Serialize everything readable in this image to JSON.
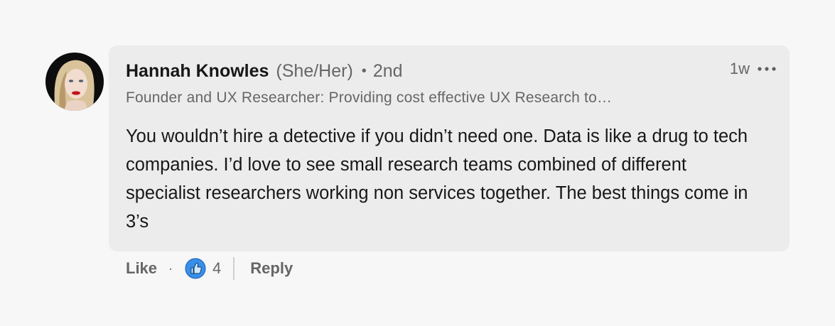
{
  "comment": {
    "author": {
      "name": "Hannah Knowles",
      "pronouns": "(She/Her)",
      "separator": "•",
      "connection_degree": "2nd",
      "headline": "Founder and UX Researcher: Providing cost effective UX Research to…",
      "avatar_icon": "profile-photo"
    },
    "timestamp": "1w",
    "more_icon": "ellipsis-horizontal-icon",
    "text": "You wouldn’t hire a detective if you didn’t need one. Data is like a drug to tech companies. I’d love to see small research teams combined of different specialist researchers working non services together. The best things come in 3’s"
  },
  "actions": {
    "like_label": "Like",
    "separator": "·",
    "reaction_icon": "like-thumbs-up-icon",
    "reaction_count": "4",
    "reply_label": "Reply"
  },
  "colors": {
    "background": "#f7f7f7",
    "bubble": "#ececec",
    "secondary_text": "#666666",
    "reaction_blue": "#378fe9"
  }
}
